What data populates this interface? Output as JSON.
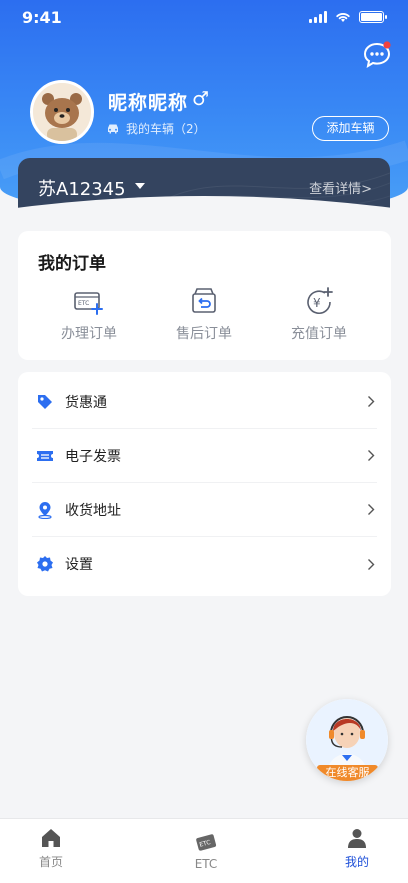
{
  "status_bar": {
    "time": "9:41"
  },
  "profile": {
    "nickname": "昵称昵称",
    "gender_symbol": "♂",
    "my_vehicles": "我的车辆（2）",
    "add_vehicle_button": "添加车辆"
  },
  "vehicle": {
    "plate": "苏A12345",
    "view_details": "查看详情>"
  },
  "orders": {
    "title": "我的订单",
    "items": [
      {
        "label": "办理订单",
        "icon": "etc-card-plus-icon"
      },
      {
        "label": "售后订单",
        "icon": "return-box-icon"
      },
      {
        "label": "充值订单",
        "icon": "yuan-plus-icon"
      }
    ]
  },
  "menu": [
    {
      "label": "货惠通",
      "icon": "tag-icon"
    },
    {
      "label": "电子发票",
      "icon": "ticket-icon"
    },
    {
      "label": "收货地址",
      "icon": "location-pin-icon"
    },
    {
      "label": "设置",
      "icon": "gear-icon"
    }
  ],
  "service": {
    "label": "在线客服"
  },
  "tabbar": [
    {
      "label": "首页",
      "icon": "home-icon",
      "active": false
    },
    {
      "label": "ETC",
      "icon": "etc-icon",
      "active": false
    },
    {
      "label": "我的",
      "icon": "person-icon",
      "active": true
    }
  ],
  "colors": {
    "primary": "#2c6ef0",
    "card_dark": "#34445f",
    "accent_orange": "#f08a2b",
    "active_tab": "#1d4fd8"
  }
}
